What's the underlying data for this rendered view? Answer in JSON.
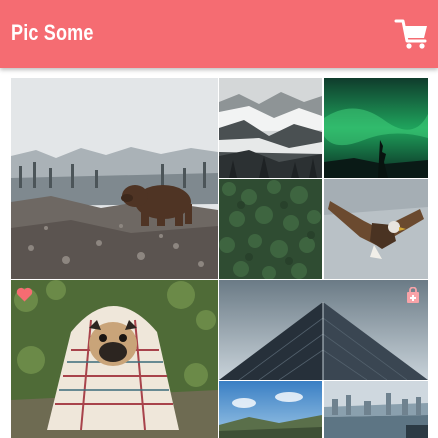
{
  "app": {
    "title": "Pic Some"
  },
  "header": {
    "cart_icon": "cart-icon"
  },
  "gallery": {
    "photos": [
      {
        "subject": "bear-on-rocky-slope",
        "favorited": false
      },
      {
        "subject": "misty-forest-mountains",
        "favorited": false
      },
      {
        "subject": "aurora-borealis",
        "favorited": false
      },
      {
        "subject": "ivy-covered-wall",
        "favorited": false
      },
      {
        "subject": "eagle-in-flight",
        "favorited": false
      },
      {
        "subject": "pug-in-blanket",
        "favorited": true
      },
      {
        "subject": "glass-skyscraper",
        "favorited": false,
        "in_cart": false
      },
      {
        "subject": "blue-sky-landscape",
        "favorited": false
      },
      {
        "subject": "harbor-city",
        "favorited": false
      }
    ],
    "icons": {
      "favorite": "heart-icon",
      "add_to_cart": "cart-add-icon"
    }
  },
  "colors": {
    "header_bg": "#f56c72",
    "header_text": "#ffffff",
    "heart": "#f56c72",
    "cart_overlay": "#f8a3a8"
  }
}
